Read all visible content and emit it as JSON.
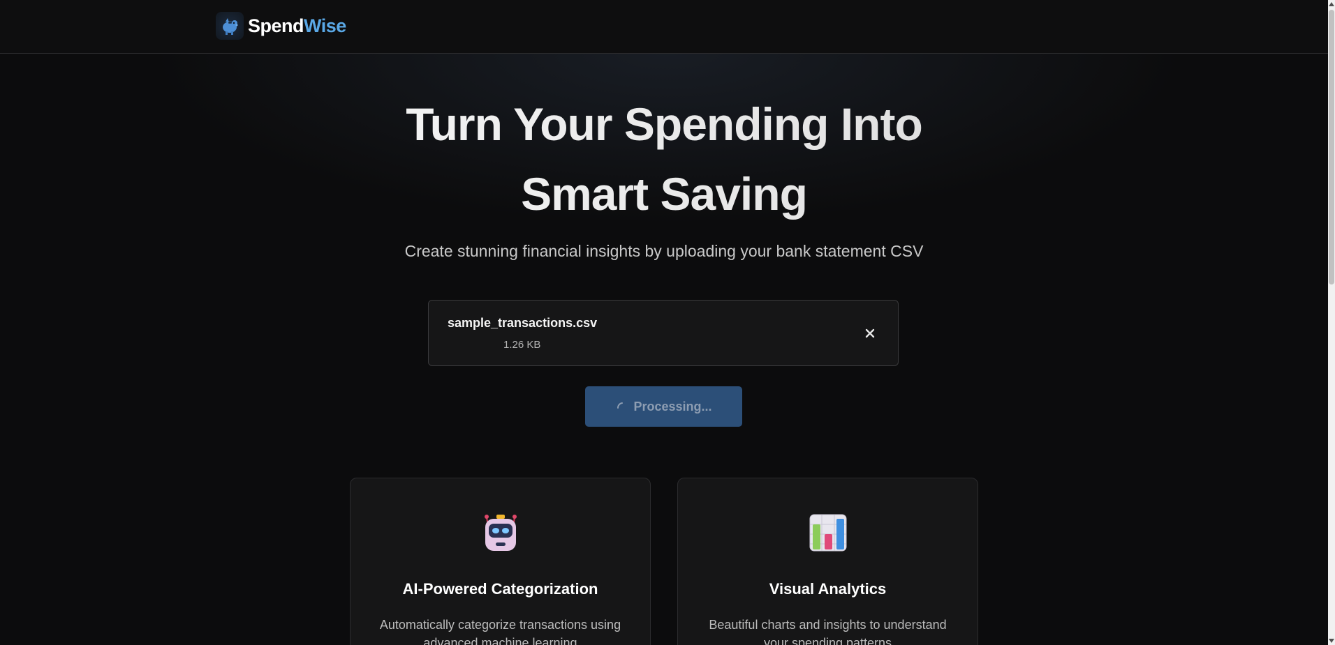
{
  "header": {
    "logo_icon": "piggy-bank-icon",
    "brand_part1": "Spend",
    "brand_part2": "Wise"
  },
  "hero": {
    "title_line1": "Turn Your Spending Into",
    "title_line2": "Smart Saving",
    "subtitle": "Create stunning financial insights by uploading your bank statement CSV"
  },
  "upload": {
    "file_name": "sample_transactions.csv",
    "file_size": "1.26 KB",
    "remove_icon": "close-icon"
  },
  "process_button": {
    "label": "Processing...",
    "icon": "spinner-icon",
    "state": "loading"
  },
  "features": [
    {
      "icon": "robot-icon",
      "title": "AI-Powered Categorization",
      "description": "Automatically categorize transactions using advanced machine learning"
    },
    {
      "icon": "bar-chart-icon",
      "title": "Visual Analytics",
      "description": "Beautiful charts and insights to understand your spending patterns"
    }
  ],
  "colors": {
    "background": "#0c0c0d",
    "brand_accent": "#5aa8e6",
    "button_bg": "#2c4f78",
    "card_bg": "#161617"
  }
}
